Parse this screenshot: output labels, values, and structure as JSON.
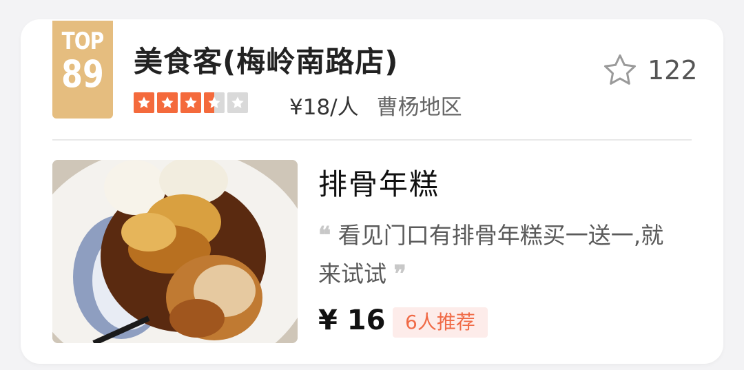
{
  "shop": {
    "rank_label": "TOP",
    "rank_number": "89",
    "name": "美食客(梅岭南路店)",
    "rating_stars": 3.5,
    "price_per_person": "¥18/人",
    "region": "曹杨地区",
    "favorite_count": "122"
  },
  "dish": {
    "name": "排骨年糕",
    "review": "看见门口有排骨年糕买一送一,就来试试",
    "open_quote": "❝",
    "close_quote": "❞",
    "price": "¥ 16",
    "recommend_badge": "6人推荐"
  },
  "colors": {
    "badge_gold": "#e5bd7f",
    "star_orange": "#f46a3c",
    "star_gray": "#d9d9d9",
    "recommend_bg": "#fdecea",
    "recommend_text": "#f06a46"
  },
  "icons": {
    "favorite": "star-outline-icon",
    "rating": "star-icon"
  }
}
